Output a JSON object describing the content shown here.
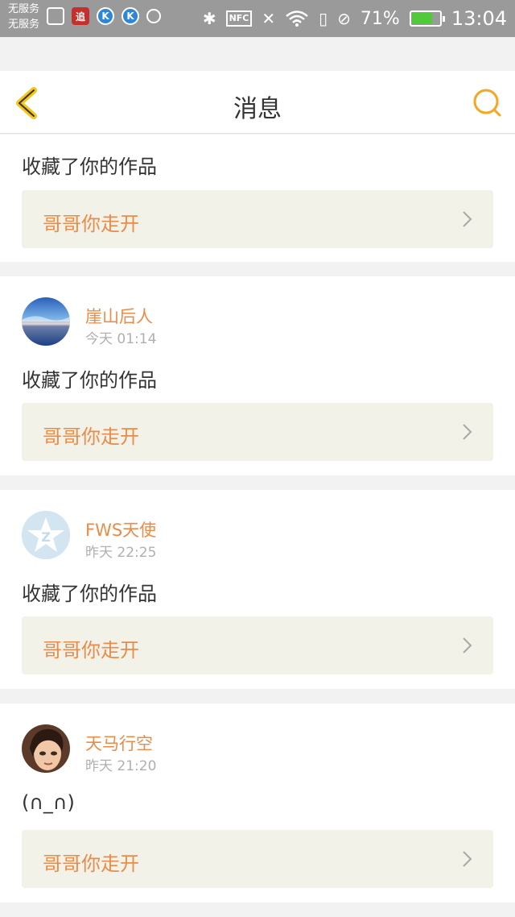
{
  "status_bar": {
    "carrier_line1": "无服务",
    "carrier_line2": "无服务",
    "battery_percent": "71%",
    "battery_level": 0.71,
    "time": "13:04",
    "left_icons": [
      "gallery-icon",
      "red-app-icon",
      "k-app-icon",
      "k-app-icon",
      "camera-icon"
    ],
    "right_icons": [
      "bluetooth-icon",
      "nfc-icon",
      "mute-icon",
      "wifi-icon",
      "sim-icon",
      "do-not-disturb-icon",
      "battery-icon"
    ]
  },
  "header": {
    "title": "消息",
    "back_icon": "chevron-left-icon",
    "search_icon": "search-icon",
    "accent": "#f5a623"
  },
  "cards": [
    {
      "message": "收藏了你的作品",
      "work_title": "哥哥你走开"
    },
    {
      "username": "崖山后人",
      "time": "今天 01:14",
      "message": "收藏了你的作品",
      "work_title": "哥哥你走开"
    },
    {
      "username": "FWS天使",
      "time": "昨天 22:25",
      "message": "收藏了你的作品",
      "work_title": "哥哥你走开"
    },
    {
      "username": "天马行空",
      "time": "昨天 21:20",
      "message": "(∩_∩)",
      "work_title": "哥哥你走开"
    }
  ],
  "colors": {
    "username": "#e98c4a",
    "work_title": "#e98c4a",
    "link_background": "#f3f2e8",
    "page_background": "#f2f2f2"
  }
}
